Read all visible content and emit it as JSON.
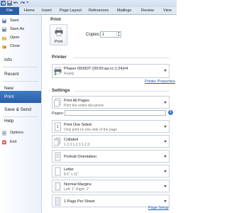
{
  "ribbon": {
    "tabs": [
      "File",
      "Home",
      "Insert",
      "Page Layout",
      "References",
      "Mailings",
      "Review",
      "View"
    ]
  },
  "quick_access": {
    "more_glyph": "="
  },
  "nav": {
    "save": "Save",
    "save_as": "Save As",
    "open": "Open",
    "close": "Close",
    "info": "Info",
    "recent": "Recent",
    "new": "New",
    "print": "Print",
    "save_send": "Save & Send",
    "help": "Help",
    "options": "Options",
    "exit": "Exit"
  },
  "print_panel": {
    "title": "Print",
    "print_button_label": "Print",
    "copies_label": "Copies:",
    "copies_value": "1",
    "printer_heading": "Printer",
    "printer_name": "Phaser 6500DT (00:00:aa:cc:1:24)#4",
    "printer_status": "Ready",
    "printer_properties_link": "Printer Properties",
    "settings_heading": "Settings",
    "pages_label": "Pages:",
    "pages_value": "",
    "pages_info_glyph": "i",
    "page_setup_link": "Page Setup",
    "settings": [
      {
        "title": "Print All Pages",
        "subtitle": "Print the entire document"
      },
      {
        "title": "Print One Sided",
        "subtitle": "Only print on one side of the page"
      },
      {
        "title": "Collated",
        "subtitle": "1,2,3    1,2,3    1,2,3"
      },
      {
        "title": "Portrait Orientation",
        "subtitle": ""
      },
      {
        "title": "Letter",
        "subtitle": "8.5\" x 11\""
      },
      {
        "title": "Normal Margins",
        "subtitle": "Left: 1\"   Right: 1\""
      },
      {
        "title": "1 Page Per Sheet",
        "subtitle": ""
      }
    ]
  },
  "colors": {
    "accent_blue": "#2a5ea8",
    "link_blue": "#1d5ea8"
  }
}
